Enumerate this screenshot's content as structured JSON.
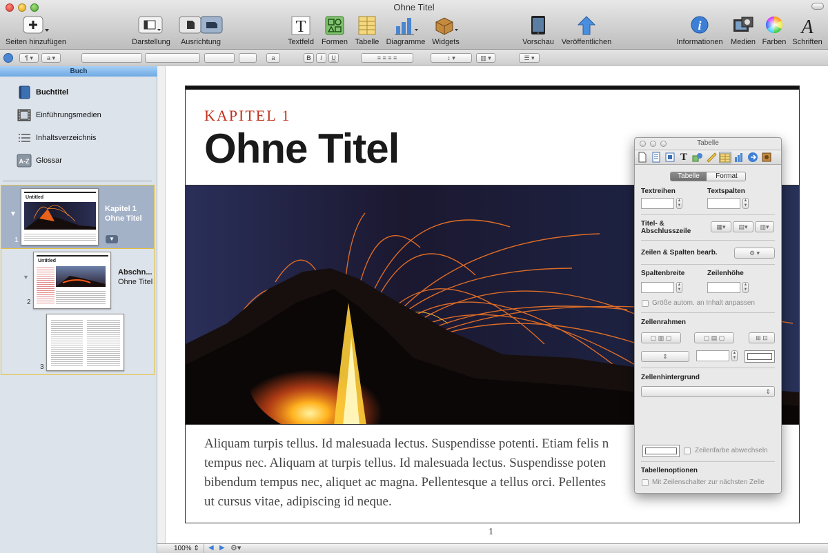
{
  "window": {
    "title": "Ohne Titel"
  },
  "toolbar": {
    "add_pages": "Seiten hinzufügen",
    "view": "Darstellung",
    "orientation": "Ausrichtung",
    "textbox": "Textfeld",
    "shapes": "Formen",
    "table": "Tabelle",
    "charts": "Diagramme",
    "widgets": "Widgets",
    "preview": "Vorschau",
    "publish": "Veröffentlichen",
    "info": "Informationen",
    "media": "Medien",
    "colors": "Farben",
    "fonts": "Schriften"
  },
  "formatbar": {
    "para_style": "¶",
    "char_style": "a",
    "bold": "B",
    "italic": "I",
    "underline": "U",
    "char_style2": "a"
  },
  "sidebar": {
    "header": "Buch",
    "items": [
      {
        "label": "Buchtitel",
        "icon": "book-icon"
      },
      {
        "label": "Einführungsmedien",
        "icon": "film-icon"
      },
      {
        "label": "Inhaltsverzeichnis",
        "icon": "list-icon"
      },
      {
        "label": "Glossar",
        "icon": "glossary-icon"
      }
    ],
    "chapters": [
      {
        "number": "1",
        "title": "Kapitel 1",
        "subtitle": "Ohne Titel",
        "thumb_title": "Untitled"
      },
      {
        "number": "2",
        "title": "Abschn...",
        "subtitle": "Ohne Titel",
        "thumb_title": "Untitled"
      },
      {
        "number": "3"
      }
    ]
  },
  "page": {
    "chapter_label": "KAPITEL 1",
    "title": "Ohne Titel",
    "body": "Aliquam turpis tellus. Id malesuada lectus. Suspendisse potenti. Etiam felis n tempus nec. Aliquam at turpis tellus. Id malesuada lectus. Suspendisse poten bibendum tempus nec, aliquet ac magna. Pellentesque a tellus orci. Pellentes ut cursus vitae, adipiscing id neque.",
    "body_lines": [
      "Aliquam turpis tellus. Id malesuada lectus. Suspendisse potenti. Etiam felis n",
      "tempus nec. Aliquam at turpis tellus. Id malesuada lectus. Suspendisse poten",
      "bibendum tempus nec, aliquet ac magna. Pellentesque a tellus orci. Pellentes",
      "ut cursus vitae, adipiscing id neque."
    ],
    "page_number": "1"
  },
  "bottombar": {
    "zoom": "100%"
  },
  "inspector": {
    "title": "Tabelle",
    "seg_table": "Tabelle",
    "seg_format": "Format",
    "rows_label": "Textreihen",
    "cols_label": "Textspalten",
    "header_footer_label_1": "Titel- &",
    "header_footer_label_2": "Abschlusszeile",
    "edit_rows_cols": "Zeilen & Spalten bearb.",
    "col_width": "Spaltenbreite",
    "row_height": "Zeilenhöhe",
    "autofit": "Größe autom. an Inhalt anpassen",
    "cell_borders": "Zellenrahmen",
    "cell_background": "Zellenhintergrund",
    "alternate_row": "Zeilenfarbe abwechseln",
    "table_options": "Tabellenoptionen",
    "tab_next": "Mit Zeilenschalter zur nächsten Zelle"
  },
  "colors": {
    "accent_red": "#c0341f",
    "selection_blue": "#a4b2c8",
    "header_blue": "#6fa9e4"
  }
}
